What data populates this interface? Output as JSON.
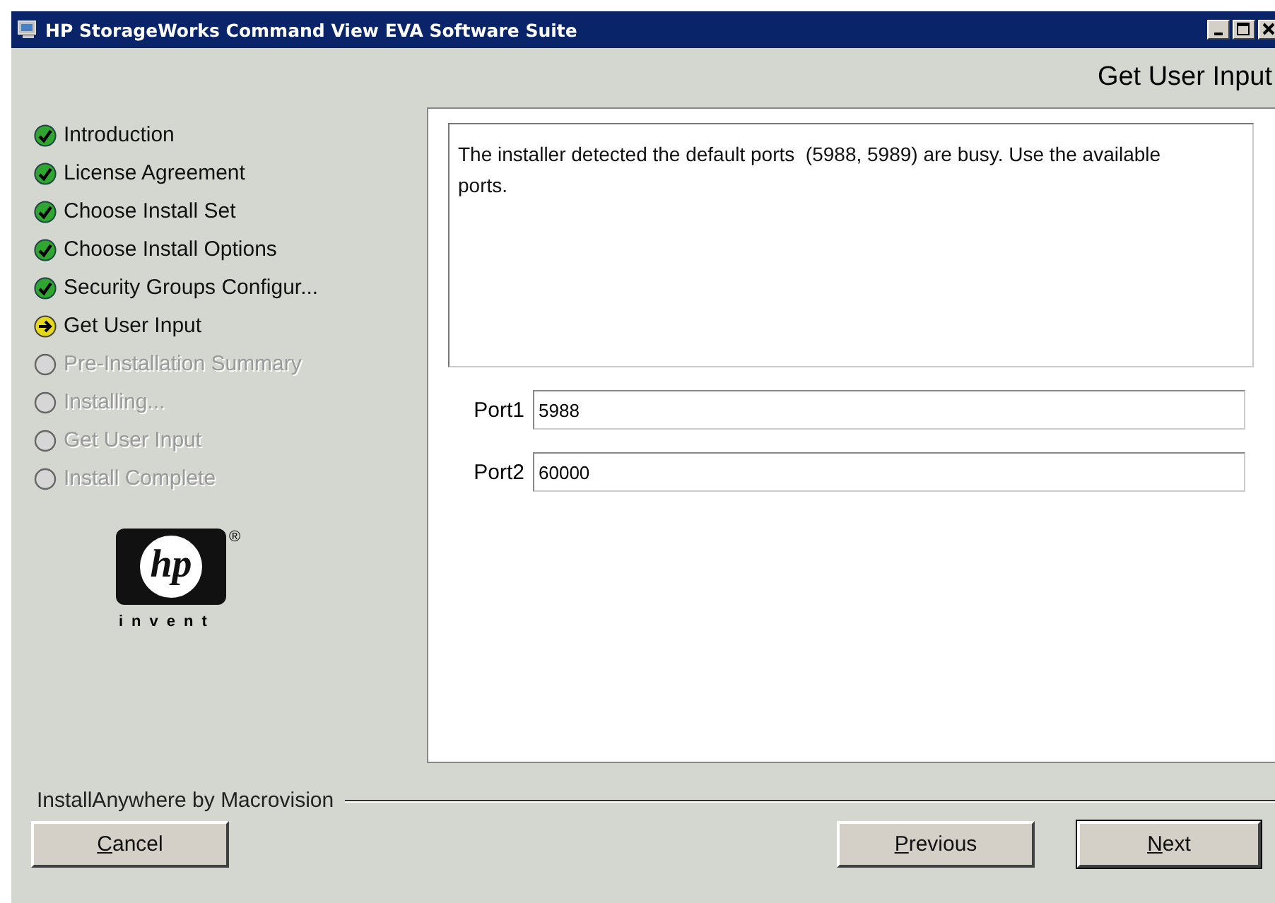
{
  "window": {
    "title": "HP StorageWorks Command View EVA Software Suite"
  },
  "header": {
    "title": "Get User Input"
  },
  "steps": [
    {
      "label": "Introduction",
      "kind": "done"
    },
    {
      "label": "License Agreement",
      "kind": "done"
    },
    {
      "label": "Choose Install Set",
      "kind": "done"
    },
    {
      "label": "Choose Install Options",
      "kind": "done"
    },
    {
      "label": "Security Groups Configur...",
      "kind": "done"
    },
    {
      "label": "Get User Input",
      "kind": "current"
    },
    {
      "label": "Pre-Installation Summary",
      "kind": "pending"
    },
    {
      "label": "Installing...",
      "kind": "pending"
    },
    {
      "label": "Get User Input",
      "kind": "pending"
    },
    {
      "label": "Install Complete",
      "kind": "pending"
    }
  ],
  "logo": {
    "mark": "hp",
    "registered": "®",
    "tagline": "invent"
  },
  "message": "The installer detected the default ports  (5988, 5989) are busy. Use the available ports.",
  "fields": [
    {
      "label": "Port1",
      "value": "5988"
    },
    {
      "label": "Port2",
      "value": "60000"
    }
  ],
  "footer": {
    "vendor": "InstallAnywhere by Macrovision"
  },
  "buttons": {
    "cancel": "Cancel",
    "previous": "Previous",
    "next": "Next"
  }
}
